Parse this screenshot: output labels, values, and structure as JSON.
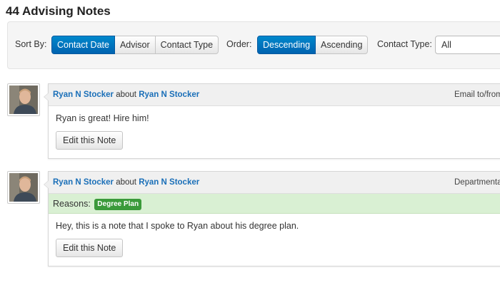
{
  "page": {
    "title": "44 Advising Notes"
  },
  "filters": {
    "sort_by_label": "Sort By:",
    "sort_options": [
      "Contact Date",
      "Advisor",
      "Contact Type"
    ],
    "sort_active": "Contact Date",
    "order_label": "Order:",
    "order_options": [
      "Descending",
      "Ascending"
    ],
    "order_active": "Descending",
    "contact_type_label": "Contact Type:",
    "contact_type_value": "All"
  },
  "notes": [
    {
      "author": "Ryan N Stocker",
      "about_word": "about",
      "subject": "Ryan N Stocker",
      "contact_type": "Email to/from",
      "reasons_label": null,
      "reasons": [],
      "text": "Ryan is great! Hire him!",
      "edit_label": "Edit this Note"
    },
    {
      "author": "Ryan N Stocker",
      "about_word": "about",
      "subject": "Ryan N Stocker",
      "contact_type": "Departmental Ad",
      "reasons_label": "Reasons:",
      "reasons": [
        "Degree Plan"
      ],
      "text": "Hey, this is a note that I spoke to Ryan about his degree plan.",
      "edit_label": "Edit this Note"
    }
  ],
  "colors": {
    "accent": "#0074c7",
    "link": "#1a6fb8",
    "reason_row": "#d9f0d3",
    "badge": "#3a9a3a"
  }
}
